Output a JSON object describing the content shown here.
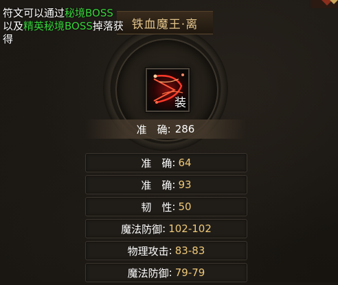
{
  "description": {
    "part1": "符文可以通过",
    "highlight1": "秘境BOSS",
    "part2": "以及",
    "highlight2": "精英秘境BOSS",
    "part3": "掉落获得"
  },
  "item": {
    "name": "铁血魔王·离",
    "tag": "装",
    "icon": "rune-slash-icon"
  },
  "main_stat": {
    "label": "准　确",
    "value": "286"
  },
  "stats": [
    {
      "label": "准　确",
      "value": "64"
    },
    {
      "label": "准　确",
      "value": "93"
    },
    {
      "label": "韧　性",
      "value": "50"
    },
    {
      "label": "魔法防御",
      "value": "102-102"
    },
    {
      "label": "物理攻击",
      "value": "83-83"
    },
    {
      "label": "魔法防御",
      "value": "79-79"
    }
  ],
  "colors": {
    "highlight": "#37d43a",
    "title": "#e2c48b",
    "value": "#f0c978"
  }
}
